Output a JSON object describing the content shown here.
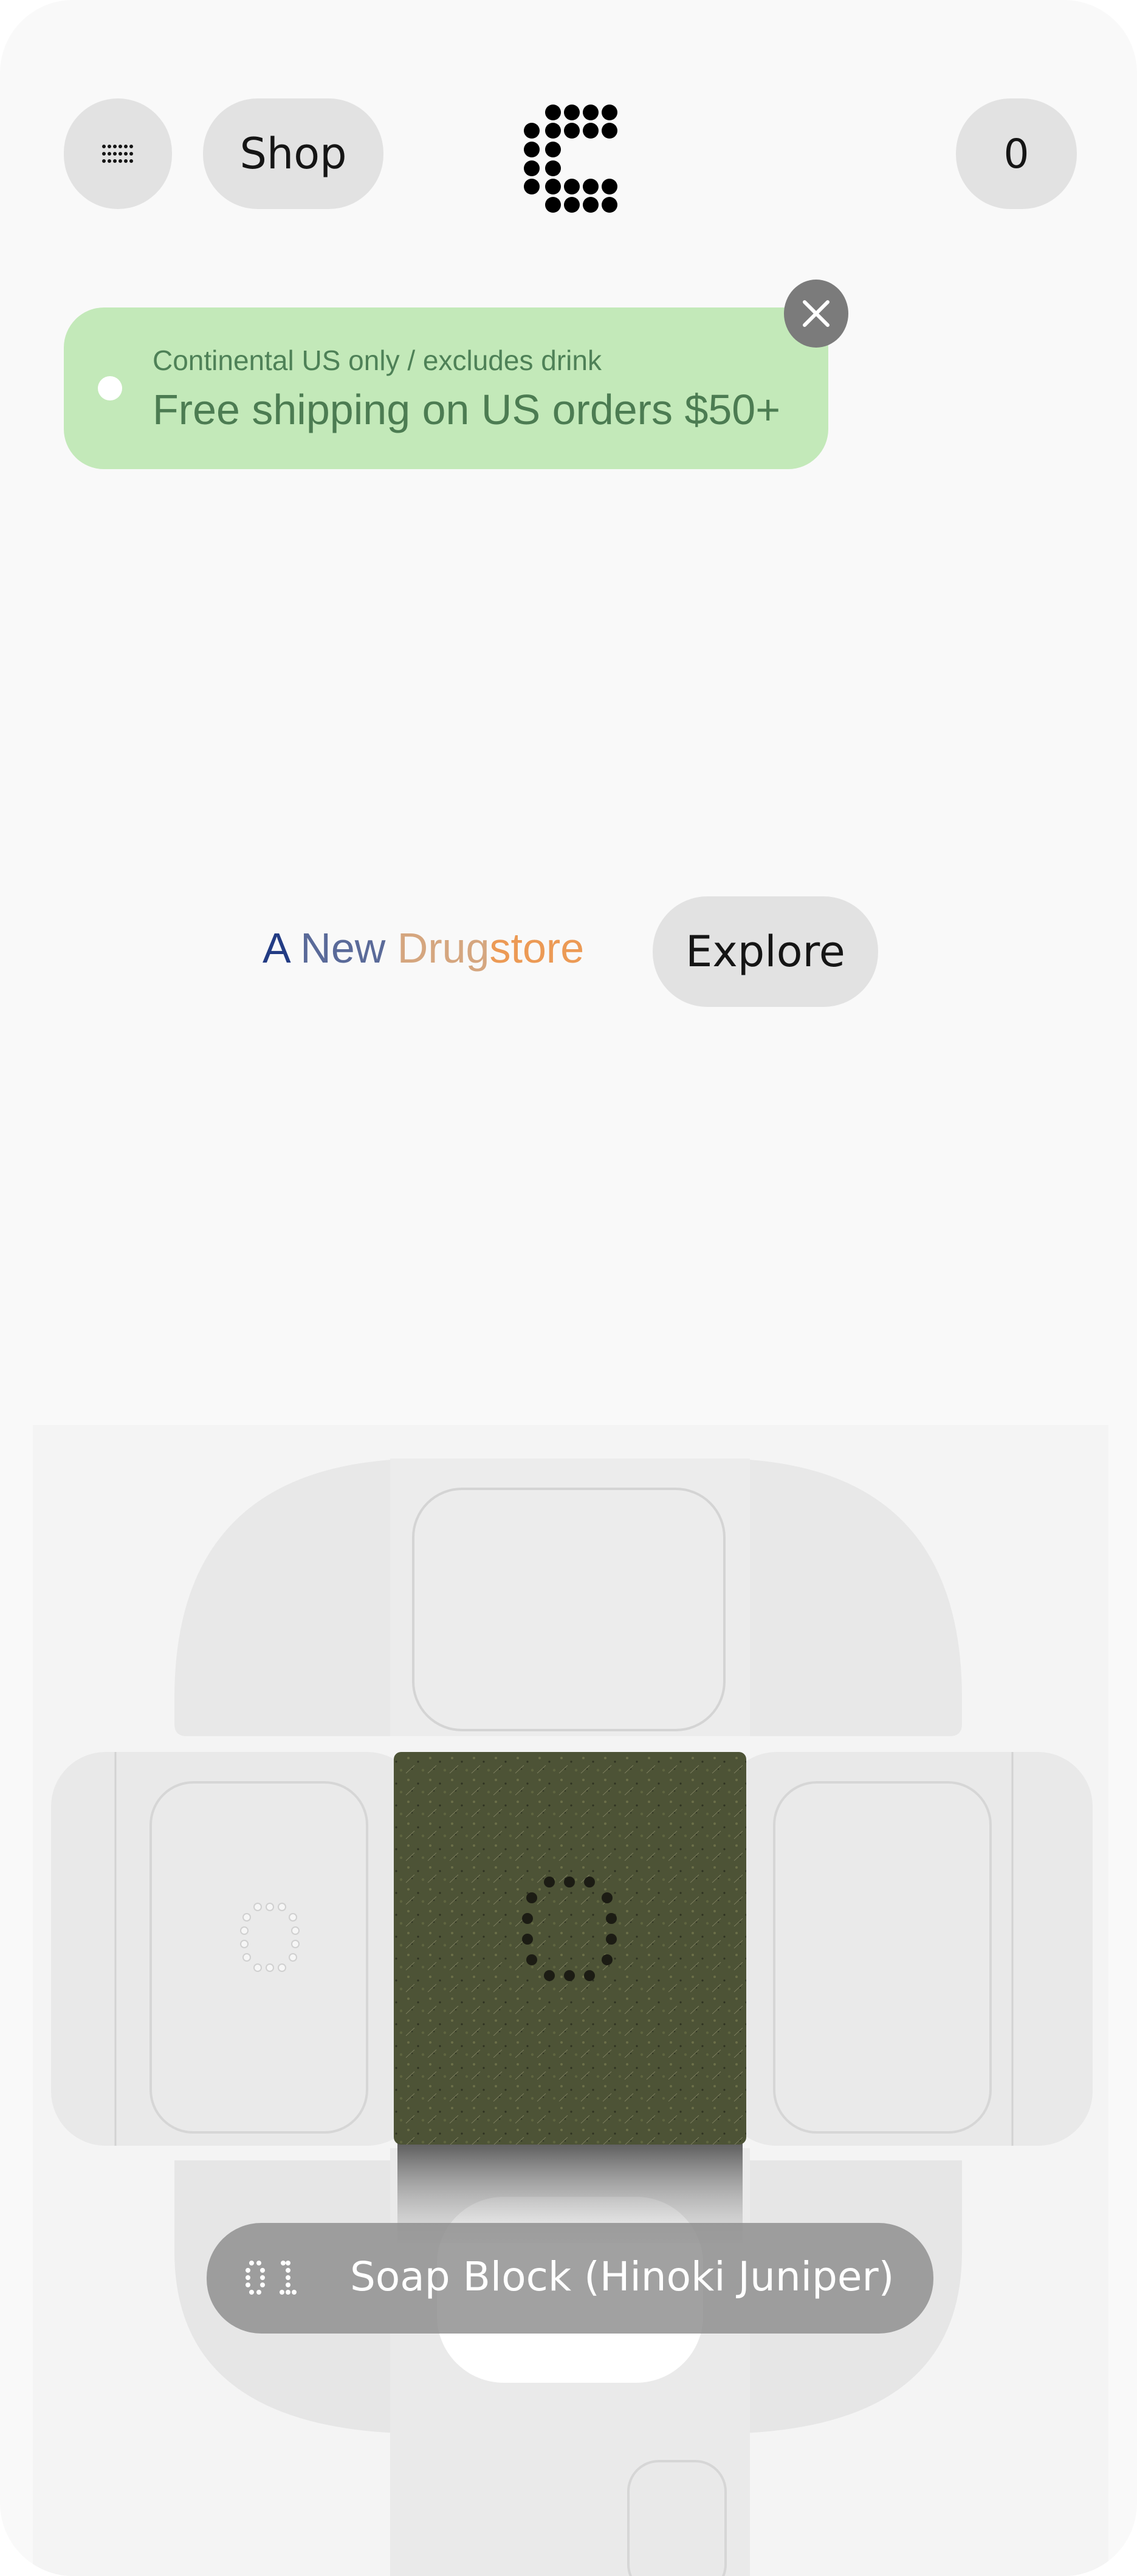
{
  "header": {
    "menu_icon": "grid-dots-icon",
    "shop_label": "Shop",
    "logo_icon": "dot-c-logo",
    "cart_count": "0"
  },
  "banner": {
    "sub": "Continental US only / excludes drink",
    "main": "Free shipping on US orders $50+",
    "background": "#c3e9b9",
    "close_icon": "close-icon"
  },
  "hero_text": {
    "tagline_part1": "A ",
    "tagline_part2": "New ",
    "tagline_part3": "Drug",
    "tagline_part4": "store",
    "explore_label": "Explore"
  },
  "product": {
    "number": "01",
    "name": "Soap Block (Hinoki Juniper)"
  },
  "colors": {
    "page_bg": "#f9f9f9",
    "pill_bg": "#e2e2e2",
    "soap": "#4d5336"
  }
}
